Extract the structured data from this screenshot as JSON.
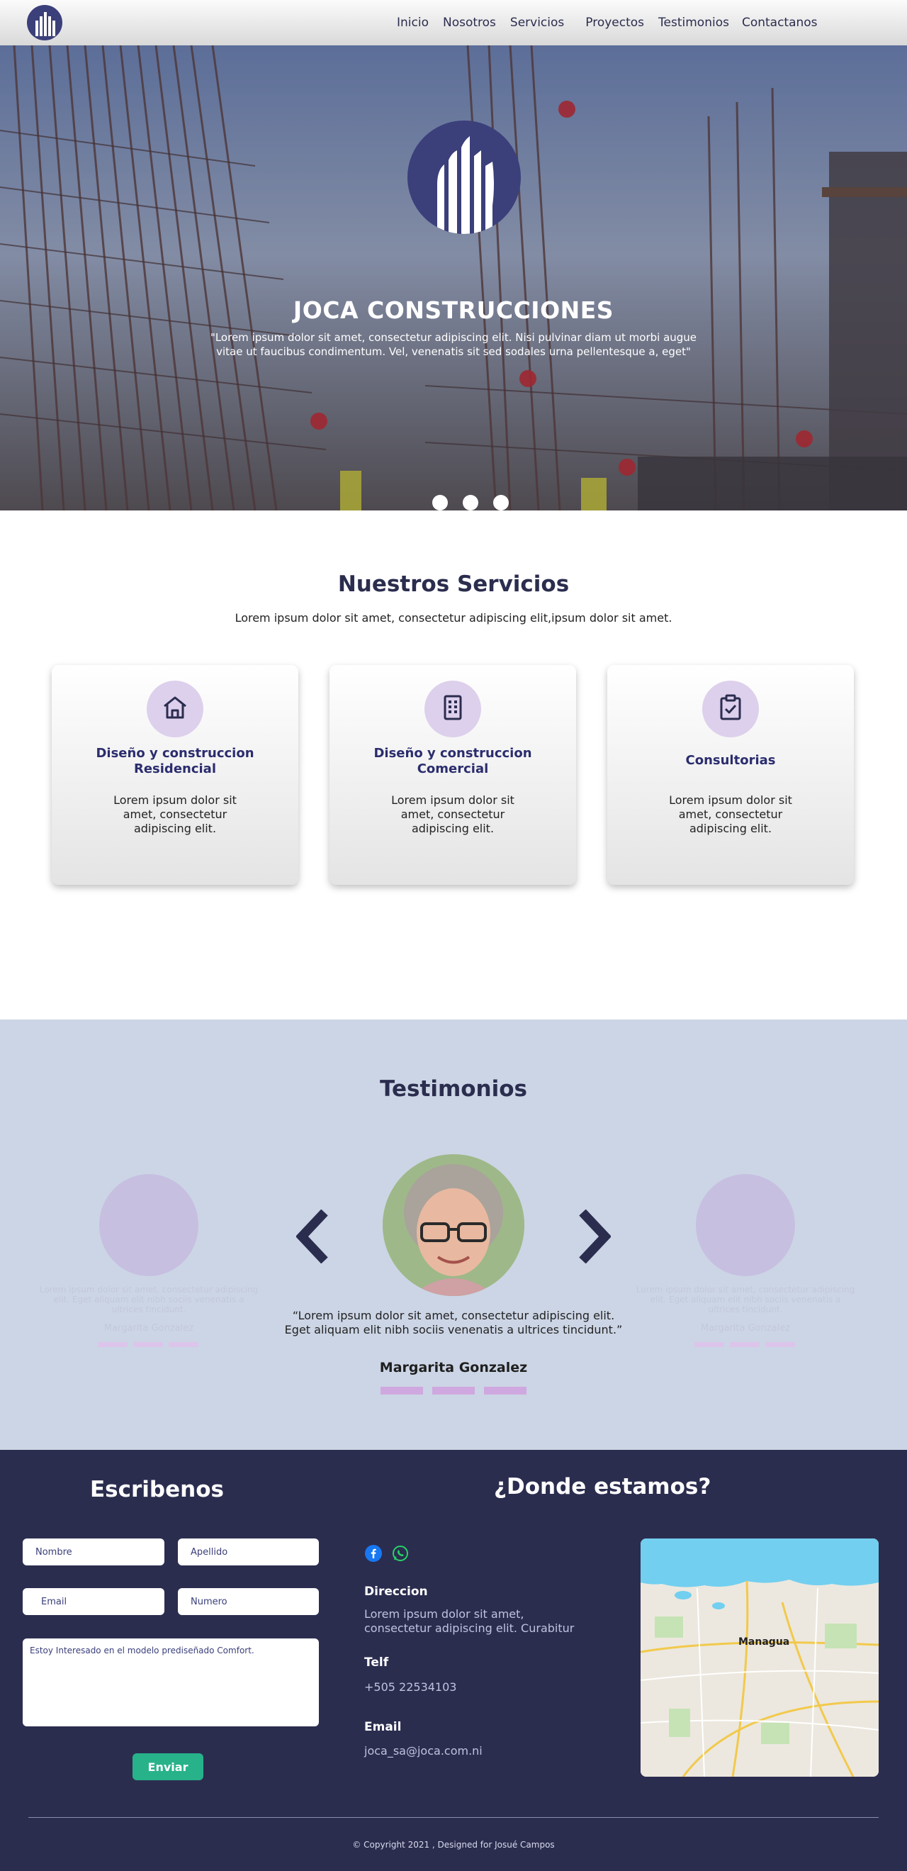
{
  "nav": {
    "links": [
      "Inicio",
      "Nosotros",
      "Servicios",
      "Proyectos",
      "Testimonios",
      "Contactanos"
    ]
  },
  "hero": {
    "title": "JOCA CONSTRUCCIONES",
    "text": "\"Lorem ipsum dolor sit amet, consectetur adipiscing elit. Nisi pulvinar diam ut morbi augue vitae ut faucibus condimentum. Vel, venenatis sit sed sodales urna pellentesque a, eget\"",
    "slides": 3,
    "active_slide": 1
  },
  "services": {
    "title": "Nuestros Servicios",
    "subtitle": "Lorem ipsum dolor sit amet, consectetur adipiscing elit,ipsum dolor sit amet.",
    "cards": [
      {
        "icon": "house-icon",
        "title": "Diseño y construccion Residencial",
        "text": "Lorem ipsum dolor sit amet, consectetur adipiscing elit."
      },
      {
        "icon": "building-icon",
        "title": "Diseño y construccion Comercial",
        "text": "Lorem ipsum dolor sit amet, consectetur adipiscing elit."
      },
      {
        "icon": "clipboard-check-icon",
        "title": "Consultorias",
        "text": "Lorem ipsum dolor sit amet, consectetur adipiscing elit."
      }
    ]
  },
  "testimonials": {
    "title": "Testimonios",
    "quote": "“Lorem ipsum dolor sit amet, consectetur adipiscing elit. Eget aliquam elit nibh sociis venenatis a ultrices tincidunt.”",
    "name": "Margarita Gonzalez",
    "ghost_quote": "Lorem ipsum dolor sit amet, consectetur adipiscing elit. Eget aliquam elit nibh sociis venenatis a ultrices tincidunt.",
    "ghost_name": "Margarita Gonzalez"
  },
  "contact": {
    "title": "Escribenos",
    "placeholders": {
      "nombre": "Nombre",
      "apellido": "Apellido",
      "email": "Email",
      "numero": "Numero"
    },
    "message": "Estoy Interesado en el modelo prediseñado Comfort.",
    "send_label": "Enviar"
  },
  "location": {
    "title": "¿Donde estamos?",
    "direccion_label": "Direccion",
    "direccion_value": "Lorem ipsum dolor sit amet, consectetur adipiscing elit. Curabitur",
    "telf_label": "Telf",
    "telf_value": "+505 22534103",
    "email_label": "Email",
    "email_value": "joca_sa@joca.com.ni",
    "map_city": "Managua"
  },
  "footer": {
    "copyright": "©   Copyright  2021 , Designed for Josué Campos"
  },
  "colors": {
    "primary": "#2b2d4f",
    "accent": "#27b28a",
    "icon_bg": "#ddd0ec",
    "testimonial_bg": "#ccd5e5"
  }
}
